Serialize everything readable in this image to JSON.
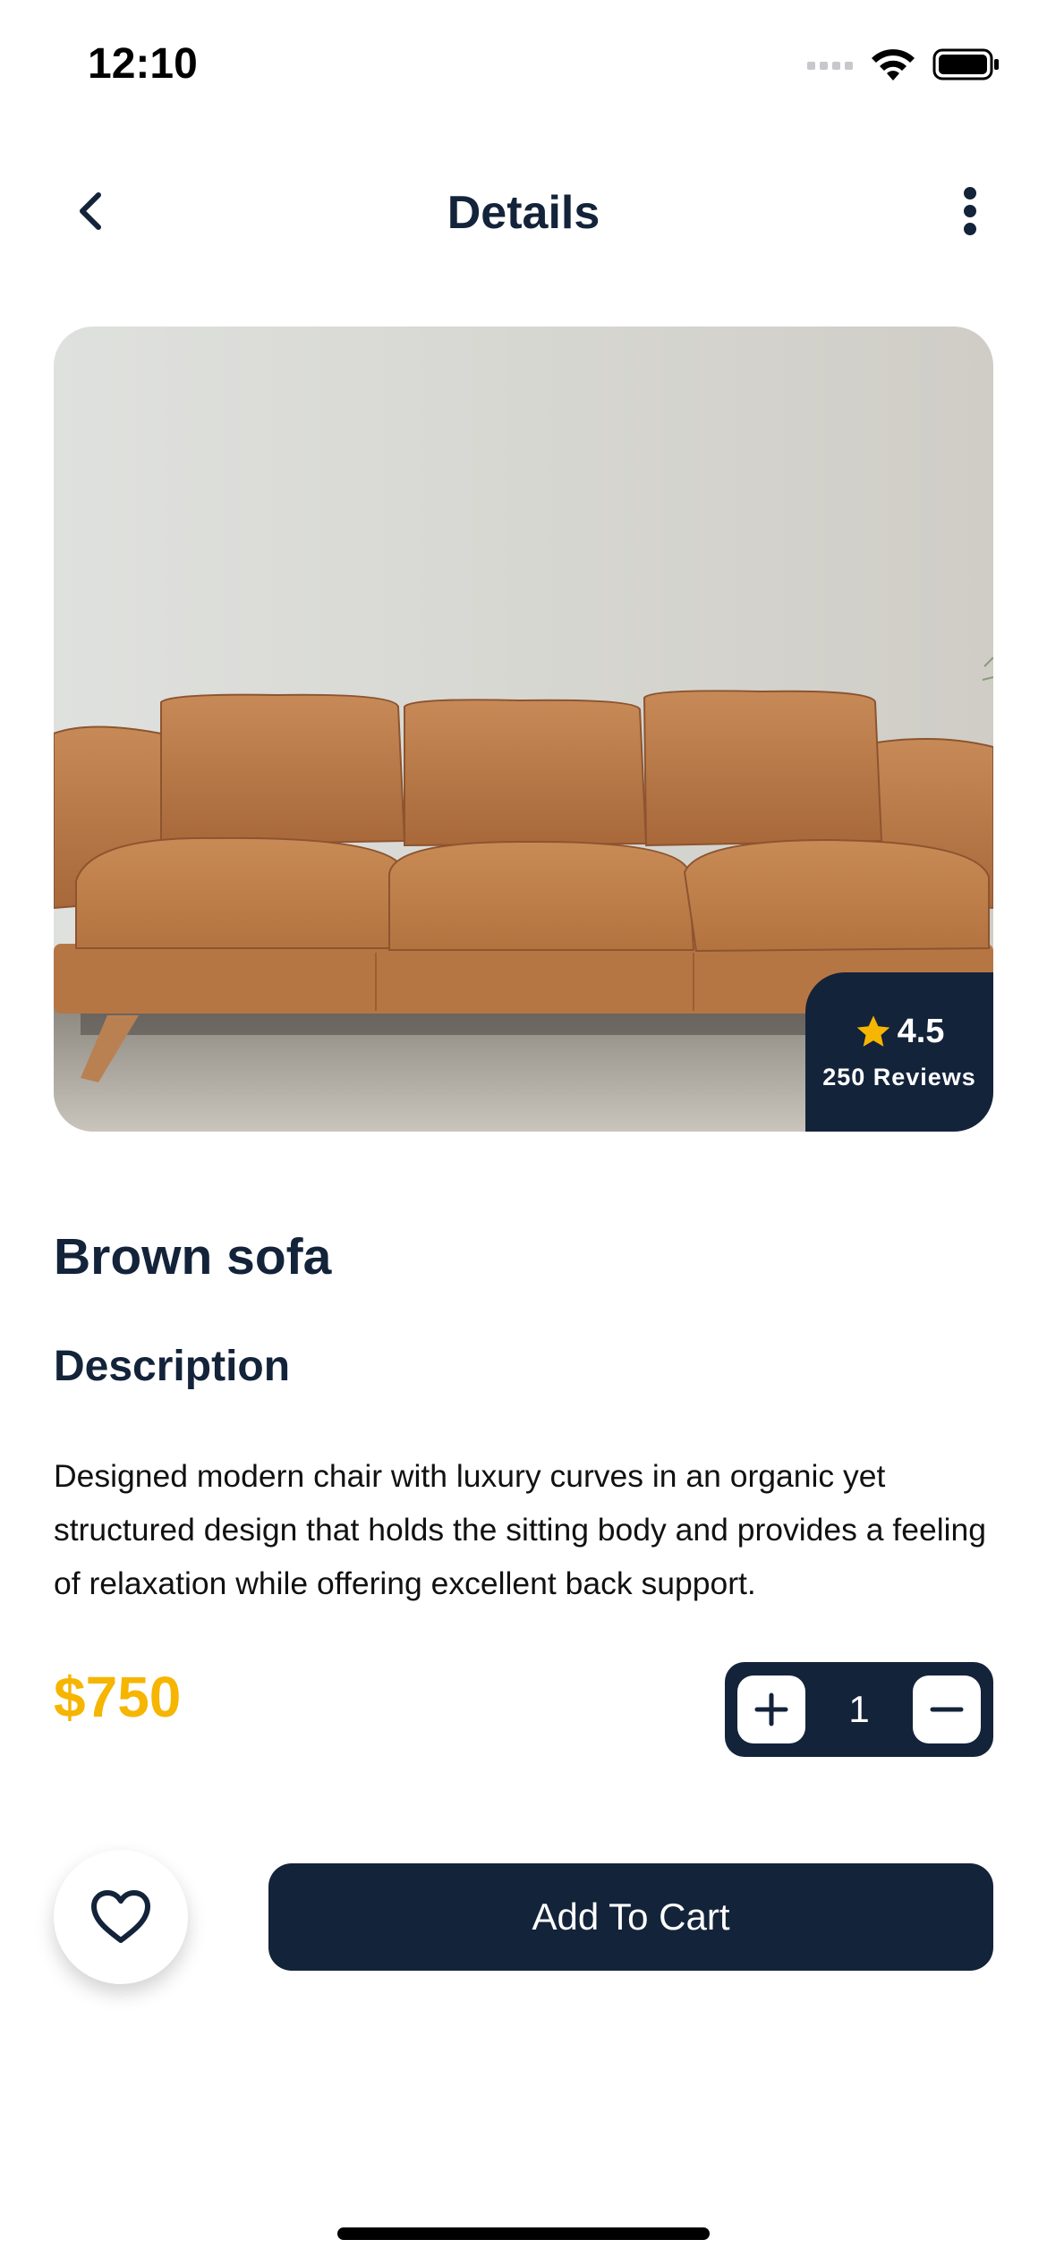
{
  "status_bar": {
    "time": "12:10",
    "icons": [
      "signal-icon",
      "wifi-icon",
      "battery-icon"
    ]
  },
  "nav": {
    "title": "Details",
    "back_icon": "chevron-left-icon",
    "more_icon": "more-vertical-icon"
  },
  "product": {
    "image_icon": "brown-leather-sofa-photo",
    "rating": "4.5",
    "rating_icon": "star-icon",
    "reviews": "250 Reviews",
    "name": "Brown sofa",
    "description_heading": "Description",
    "description": "Designed modern chair with luxury curves in an organic yet structured design that holds the sitting body and provides a feeling of relaxation while offering excellent back support.",
    "price": "$750"
  },
  "quantity": {
    "value": "1",
    "increase_icon": "plus-icon",
    "decrease_icon": "minus-icon"
  },
  "actions": {
    "favorite_icon": "heart-icon",
    "add_to_cart_label": "Add To Cart"
  },
  "colors": {
    "primary": "#13233a",
    "accent_price": "#f6b500",
    "star": "#f6b500",
    "background": "#ffffff"
  }
}
